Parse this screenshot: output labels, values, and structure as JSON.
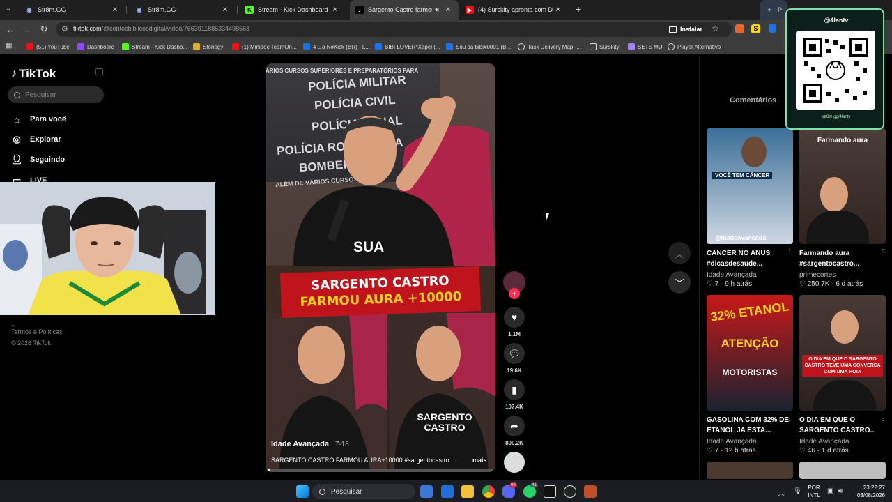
{
  "browser": {
    "tabs": [
      {
        "title": "Str8m.GG"
      },
      {
        "title": "Str8m.GG"
      },
      {
        "title": "Stream - Kick Dashboard"
      },
      {
        "title": "Sargento Castro farmou Au"
      },
      {
        "title": "(4) Surskity apronta com Duduc"
      }
    ],
    "side_tab": "Peça a",
    "url_host": "tiktok.com",
    "url_path": "/@contosbiblicosdigital/video/7663911885334498568",
    "install_label": "Instalar",
    "bookmarks": [
      "(51) YouTube",
      "Dashboard",
      "Stream - Kick Dashb...",
      "Stonegy",
      "(1) Minidoc TeamOn...",
      "4 L a N#Kick (BR) - L...",
      "BIBI LOVER*Xapel (...",
      "Sou da bibi#0001 (B...",
      "Task Delivery Map -...",
      "Surskity",
      "SETS MU",
      "Player Alternativo"
    ]
  },
  "tiktok": {
    "logo": "TikTok",
    "search_placeholder": "Pesquisar",
    "nav": [
      "Para você",
      "Explorar",
      "Seguindo",
      "LIVE"
    ],
    "footer_partial": "Programa",
    "footer_terms": "Termos e Políticas",
    "footer_copy": "© 2026 TikTok"
  },
  "video": {
    "wall_lines": [
      "ÁRIOS CURSOS SUPERIORES E PREPARATÓRIOS PARA",
      "POLÍCIA MILITAR",
      "POLÍCIA CIVIL",
      "POLÍCIA PENAL",
      "POLÍCIA RODOVIÁRIA",
      "BOMBEIRO",
      "ALÉM DE VÁRIOS CURSOS"
    ],
    "sua": "SUA",
    "banner_line1": "SARGENTO CASTRO",
    "banner_line2": "FARMOU AURA +10000",
    "shirt_text": "SARGENTO CASTRO",
    "author": "Idade Avançada",
    "date": " · 7-18",
    "caption": "SARGENTO CASTRO FARMOU AURA+10000 #sargentocastro ...",
    "more": "mais"
  },
  "actions": {
    "likes": "1.1M",
    "comments": "19.6K",
    "saves": "107.4K",
    "shares": "800.2K"
  },
  "right": {
    "comments_tab": "Comentários",
    "cards": [
      {
        "overlay": "VOCÊ TEM CÂNCER",
        "handle": "@idadeavancada",
        "title": "CANCER NO ANUS #dicasdesaude...",
        "author": "Idade Avançada",
        "likes": "7",
        "age": "9 h atrás",
        "color": "#2f6fa6"
      },
      {
        "overlay": "Farmando aura",
        "handle": "",
        "title": "Farmando aura #sargentocastro...",
        "author": "primecortes",
        "likes": "250.7K",
        "age": "6 d atrás",
        "color": "#4a3a36"
      },
      {
        "overlay": "32% ETANOL",
        "handle": "ATENÇÃO",
        "sub": "MOTORISTAS",
        "title": "GASOLINA COM 32% DE ETANOL JA ESTA...",
        "author": "Idade Avançada",
        "likes": "7",
        "age": "12 h atrás",
        "color": "#c81818"
      },
      {
        "overlay": "O DIA EM QUE O SARGENTO CASTRO TEVE UMA CONVERSA COM UMA HOIA",
        "handle": "",
        "title": "O DIA EM QUE O SARGENTO CASTRO...",
        "author": "Idade Avançada",
        "likes": "46",
        "age": "1 d atrás",
        "color": "#3e302c"
      }
    ]
  },
  "qr": {
    "handle": "@4lantv",
    "url": "str8m.gg/4lantv"
  },
  "taskbar": {
    "search": "Pesquisar",
    "lang1": "POR",
    "lang2": "INTL",
    "time": "23:22:27",
    "date": "03/08/2026",
    "badge1": "99",
    "badge2": "41"
  }
}
